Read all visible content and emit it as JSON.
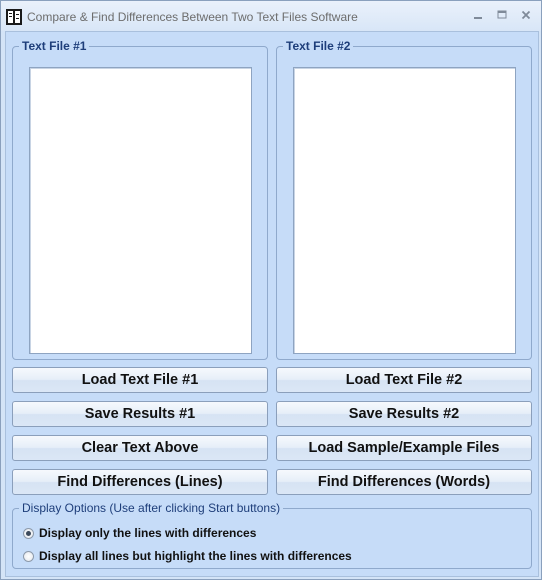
{
  "window": {
    "title": "Compare & Find Differences Between Two Text Files Software"
  },
  "groups": {
    "file1_label": "Text File #1",
    "file1_text": "",
    "file2_label": "Text File #2",
    "file2_text": ""
  },
  "buttons": {
    "load1": "Load Text File #1",
    "load2": "Load Text File #2",
    "save1": "Save Results #1",
    "save2": "Save Results #2",
    "clear": "Clear Text Above",
    "sample": "Load Sample/Example Files",
    "diff_lines": "Find Differences (Lines)",
    "diff_words": "Find Differences (Words)"
  },
  "display_options": {
    "label": "Display Options (Use after clicking Start buttons)",
    "option1": "Display only the lines with differences",
    "option2": "Display all lines but highlight the lines with differences",
    "selected": "option1"
  },
  "colors": {
    "client_bg": "#c6dcf8",
    "legend_text": "#1e3e7a"
  }
}
